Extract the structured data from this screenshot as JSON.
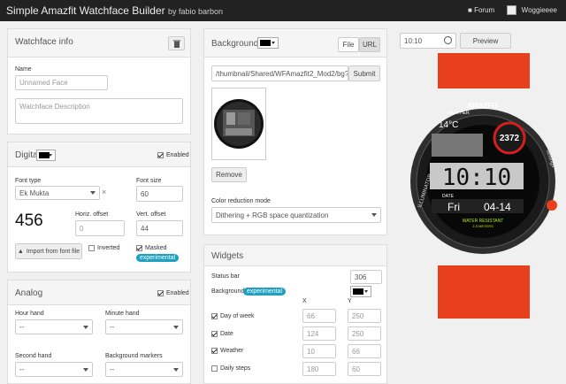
{
  "navbar": {
    "title": "Simple Amazfit Watchface Builder",
    "byline": "by fabio barbon",
    "forum": "Forum",
    "user": "Woggieeee"
  },
  "watchface_info": {
    "title": "Watchface info",
    "name_label": "Name",
    "name_placeholder": "Unnamed Face",
    "desc_placeholder": "Watchface Description"
  },
  "digital": {
    "title": "Digital",
    "enabled": "Enabled",
    "font_type_label": "Ek Mukta",
    "font_type_heading": "Font type",
    "font_size_heading": "Font size",
    "font_size": "60",
    "preview": "456",
    "h_offset_label": "Horiz. offset",
    "h_offset": "0",
    "v_offset_label": "Vert. offset",
    "v_offset": "44",
    "import_button": "Import from font file",
    "inverted": "Inverted",
    "masked": "Masked",
    "experimental": "experimental"
  },
  "analog": {
    "title": "Analog",
    "enabled": "Enabled",
    "hour_hand": "Hour hand",
    "minute_hand": "Minute hand",
    "second_hand": "Second hand",
    "bg_markers": "Background markers",
    "empty": "--"
  },
  "background": {
    "title": "Background",
    "file": "File",
    "url": "URL",
    "url_value": "/thumbnail/Shared/WFAmazfit2_Mod2/bg?",
    "submit": "Submit",
    "remove": "Remove",
    "color_reduction_label": "Color reduction mode",
    "color_reduction_value": "Dithering + RGB space quantization"
  },
  "widgets": {
    "title": "Widgets",
    "status_bar": "Status bar",
    "status_bar_value": "306",
    "background": "Background",
    "experimental": "experimental",
    "x_header": "X",
    "y_header": "Y",
    "rows": [
      {
        "label": "Day of week",
        "checked": true,
        "x": "66",
        "y": "250"
      },
      {
        "label": "Date",
        "checked": true,
        "x": "124",
        "y": "250"
      },
      {
        "label": "Weather",
        "checked": true,
        "x": "10",
        "y": "66"
      },
      {
        "label": "Daily steps",
        "checked": false,
        "x": "180",
        "y": "60"
      }
    ]
  },
  "preview": {
    "time": "10:10",
    "preview_button": "Preview",
    "watch": {
      "brand": "AMAZFIT",
      "weather_label": "WEATHER",
      "temp": "14°C",
      "steps": "2372",
      "time": "10:10",
      "date_label": "DATE",
      "day": "Fri",
      "date": "04-14",
      "water": "WATER RESISTANT",
      "atm": "2-3 METERS",
      "illuminator": "ILLUMINATOR",
      "settings": "settings"
    }
  },
  "colors": {
    "accent": "#1fa0c0",
    "navbar": "#222222",
    "strap": "#e8401c",
    "watch_green": "#b8f000"
  }
}
